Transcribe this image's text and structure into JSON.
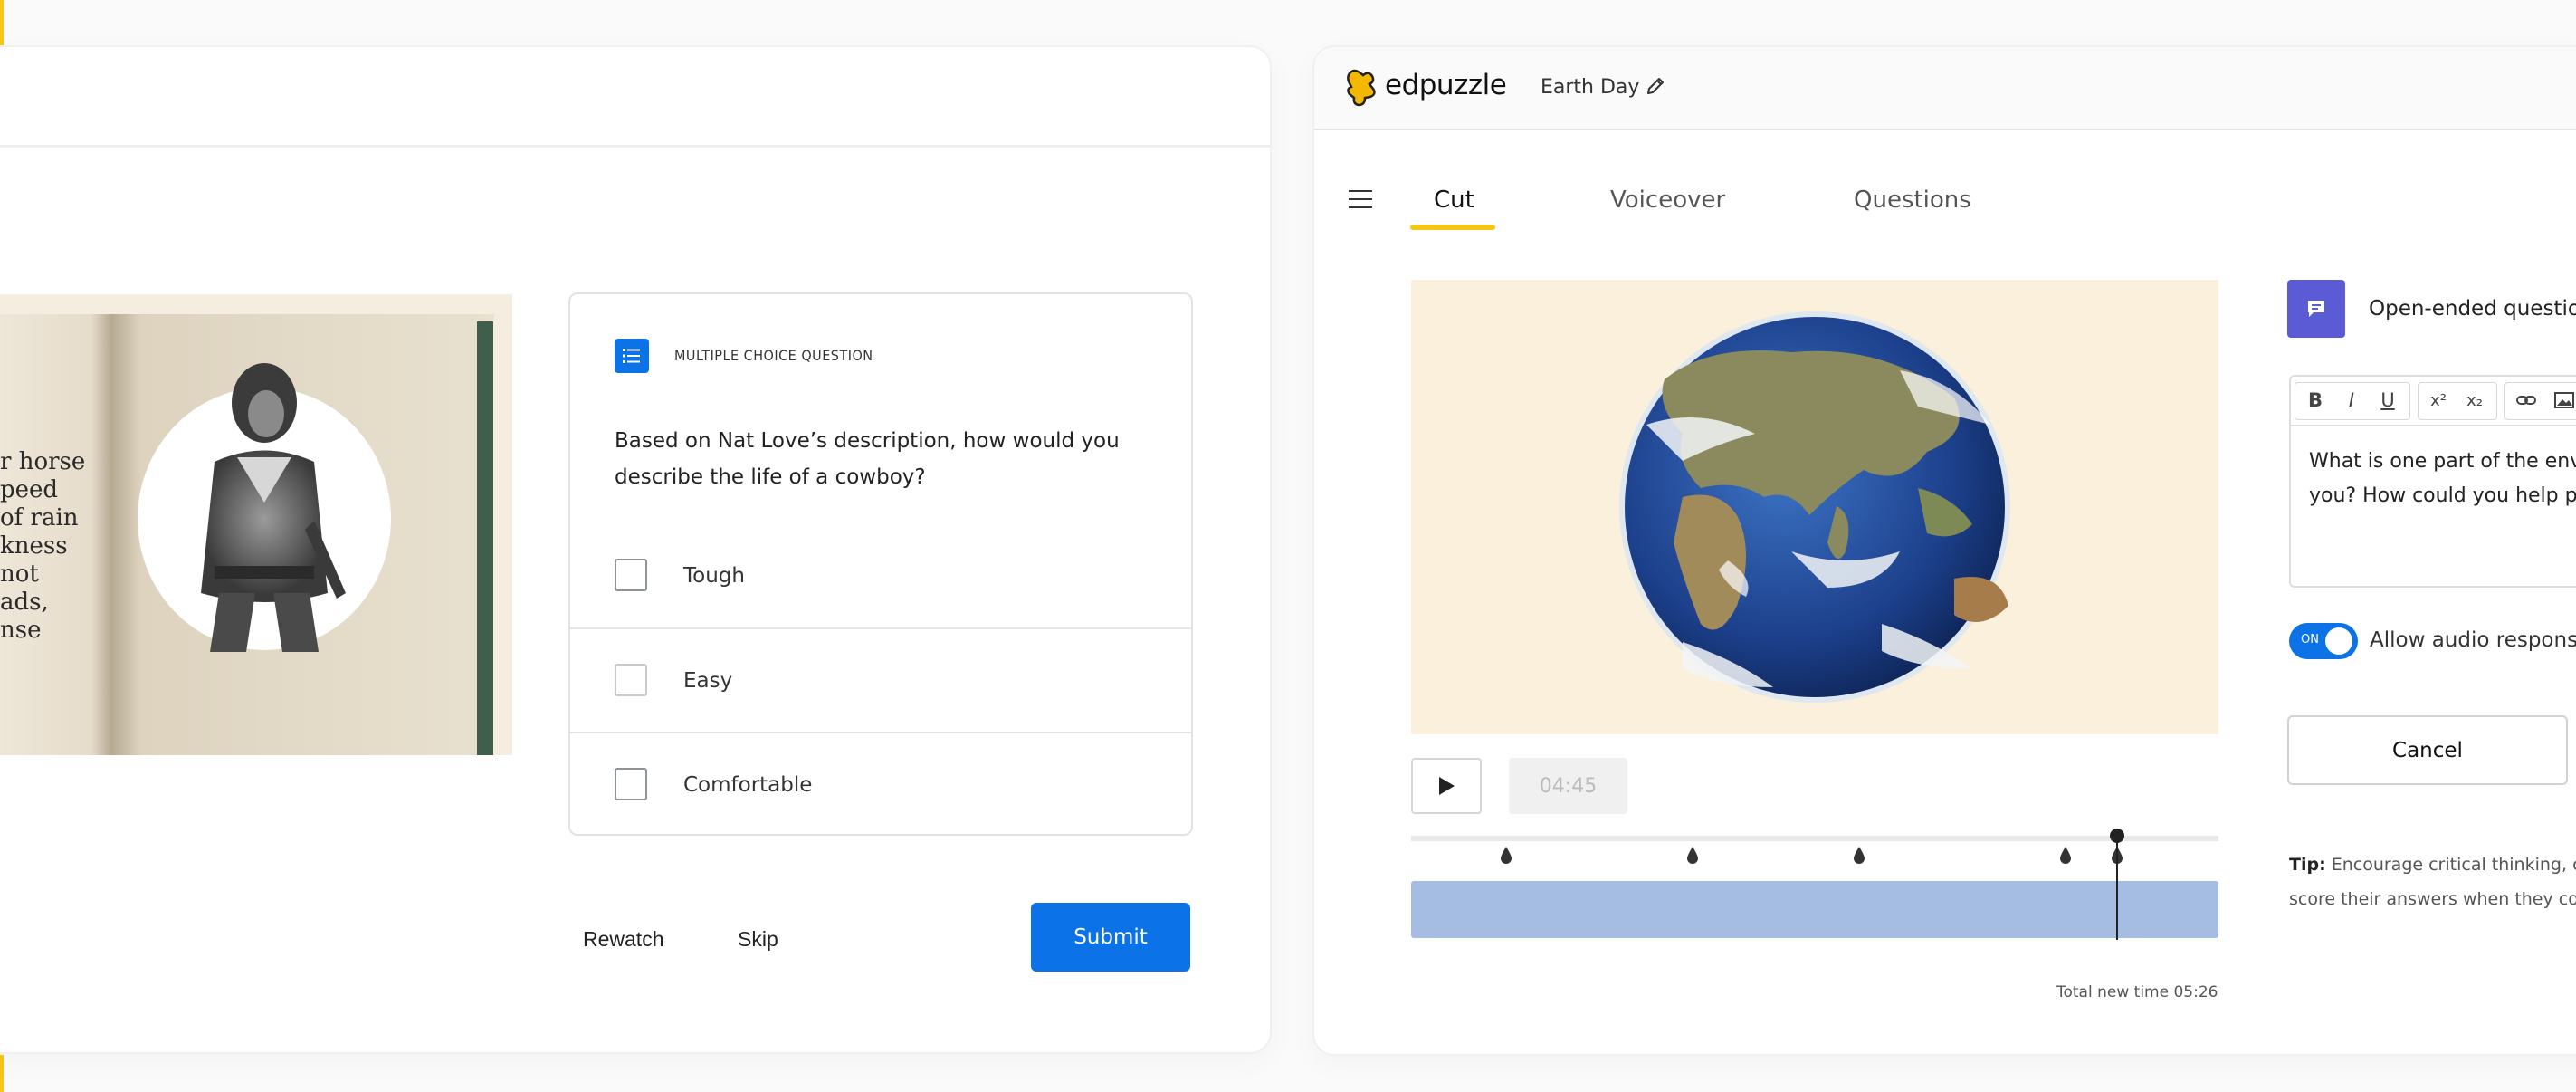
{
  "left": {
    "book_text_lines": [
      "r horse",
      "peed",
      "of rain",
      "kness",
      " not",
      "ads,",
      "nse"
    ],
    "question": {
      "type_label": "MULTIPLE CHOICE QUESTION",
      "text": "Based on Nat Love’s description, how would you describe the life of a cowboy?",
      "options": [
        "Tough",
        "Easy",
        "Comfortable"
      ]
    },
    "actions": {
      "rewatch_label": "Rewatch",
      "skip_label": "Skip",
      "submit_label": "Submit"
    }
  },
  "right": {
    "logo_text": "edpuzzle",
    "project_title": "Earth Day",
    "tabs": {
      "cut": "Cut",
      "voiceover": "Voiceover",
      "questions": "Questions"
    },
    "player": {
      "time": "04:45",
      "total_time": "Total new time 05:26"
    },
    "question_panel": {
      "type_label": "Open-ended questior",
      "editor_toolbar": [
        "B",
        "I",
        "U",
        "x²",
        "x₂",
        "link-icon",
        "image-icon"
      ],
      "editor_lines": [
        "What is one part of the envir",
        "you? How could you help pro"
      ],
      "toggle_state": "ON",
      "audio_label": "Allow audio responses",
      "cancel_label": "Cancel",
      "tip_bold": "Tip:",
      "tip_lines": [
        " Encourage critical thinking, c",
        "score their answers when they co"
      ]
    }
  },
  "colors": {
    "primary": "#0b72e7",
    "accent_yellow": "#f5c518",
    "clip_bar": "#a6bde3",
    "oe_icon": "#5b5bd6"
  }
}
